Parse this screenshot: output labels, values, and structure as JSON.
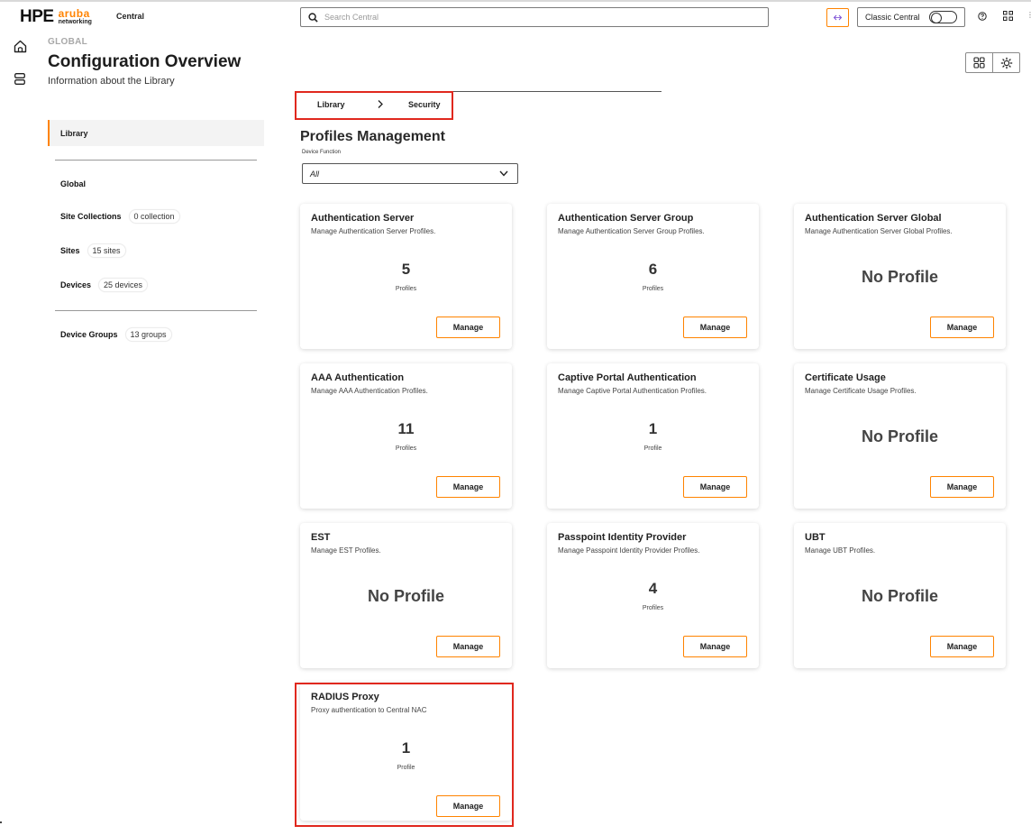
{
  "header": {
    "logo_hpe": "HPE",
    "logo_aruba": "aruba",
    "logo_networking": "networking",
    "app_name": "Central",
    "search_placeholder": "Search Central",
    "classic_label": "Classic Central",
    "accent_color": "#ff8300"
  },
  "page": {
    "scope": "GLOBAL",
    "title": "Configuration Overview",
    "subtitle": "Information about the Library"
  },
  "sidebar": {
    "library": "Library",
    "items": [
      {
        "label": "Global",
        "badge": ""
      },
      {
        "label": "Site Collections",
        "badge": "0 collection"
      },
      {
        "label": "Sites",
        "badge": "15 sites"
      },
      {
        "label": "Devices",
        "badge": "25 devices"
      },
      {
        "label": "Device Groups",
        "badge": "13 groups"
      }
    ]
  },
  "breadcrumb": {
    "library": "Library",
    "security": "Security"
  },
  "main": {
    "title": "Profiles Management",
    "device_function_label": "Device Function",
    "device_function_value": "All",
    "manage_label": "Manage",
    "cards": [
      {
        "title": "Authentication Server",
        "desc": "Manage Authentication Server Profiles.",
        "count": "5",
        "unit": "Profiles"
      },
      {
        "title": "Authentication Server Group",
        "desc": "Manage Authentication Server Group Profiles.",
        "count": "6",
        "unit": "Profiles"
      },
      {
        "title": "Authentication Server Global",
        "desc": "Manage Authentication Server Global Profiles.",
        "no_profile": "No Profile"
      },
      {
        "title": "AAA Authentication",
        "desc": "Manage AAA Authentication Profiles.",
        "count": "11",
        "unit": "Profiles"
      },
      {
        "title": "Captive Portal Authentication",
        "desc": "Manage Captive Portal Authentication Profiles.",
        "count": "1",
        "unit": "Profile"
      },
      {
        "title": "Certificate Usage",
        "desc": "Manage Certificate Usage Profiles.",
        "no_profile": "No Profile"
      },
      {
        "title": "EST",
        "desc": "Manage EST Profiles.",
        "no_profile": "No Profile"
      },
      {
        "title": "Passpoint Identity Provider",
        "desc": "Manage Passpoint Identity Provider Profiles.",
        "count": "4",
        "unit": "Profiles"
      },
      {
        "title": "UBT",
        "desc": "Manage UBT Profiles.",
        "no_profile": "No Profile"
      },
      {
        "title": "RADIUS Proxy",
        "desc": "Proxy authentication to Central NAC",
        "count": "1",
        "unit": "Profile"
      }
    ]
  }
}
